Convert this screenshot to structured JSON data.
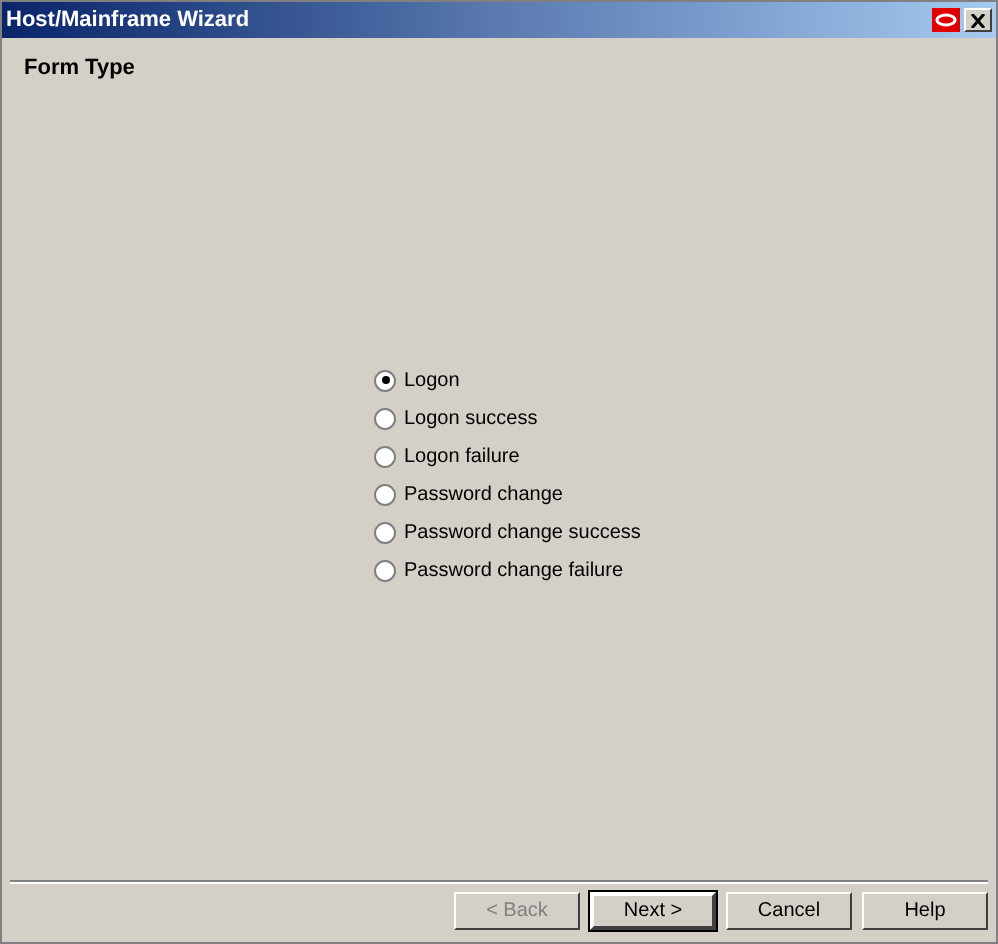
{
  "window": {
    "title": "Host/Mainframe Wizard"
  },
  "heading": "Form Type",
  "options": [
    {
      "label": "Logon",
      "selected": true
    },
    {
      "label": "Logon success",
      "selected": false
    },
    {
      "label": "Logon failure",
      "selected": false
    },
    {
      "label": "Password change",
      "selected": false
    },
    {
      "label": "Password change success",
      "selected": false
    },
    {
      "label": "Password change failure",
      "selected": false
    }
  ],
  "buttons": [
    {
      "label": "< Back",
      "disabled": true,
      "default": false
    },
    {
      "label": "Next >",
      "disabled": false,
      "default": true
    },
    {
      "label": "Cancel",
      "disabled": false,
      "default": false
    },
    {
      "label": "Help",
      "disabled": false,
      "default": false
    }
  ]
}
